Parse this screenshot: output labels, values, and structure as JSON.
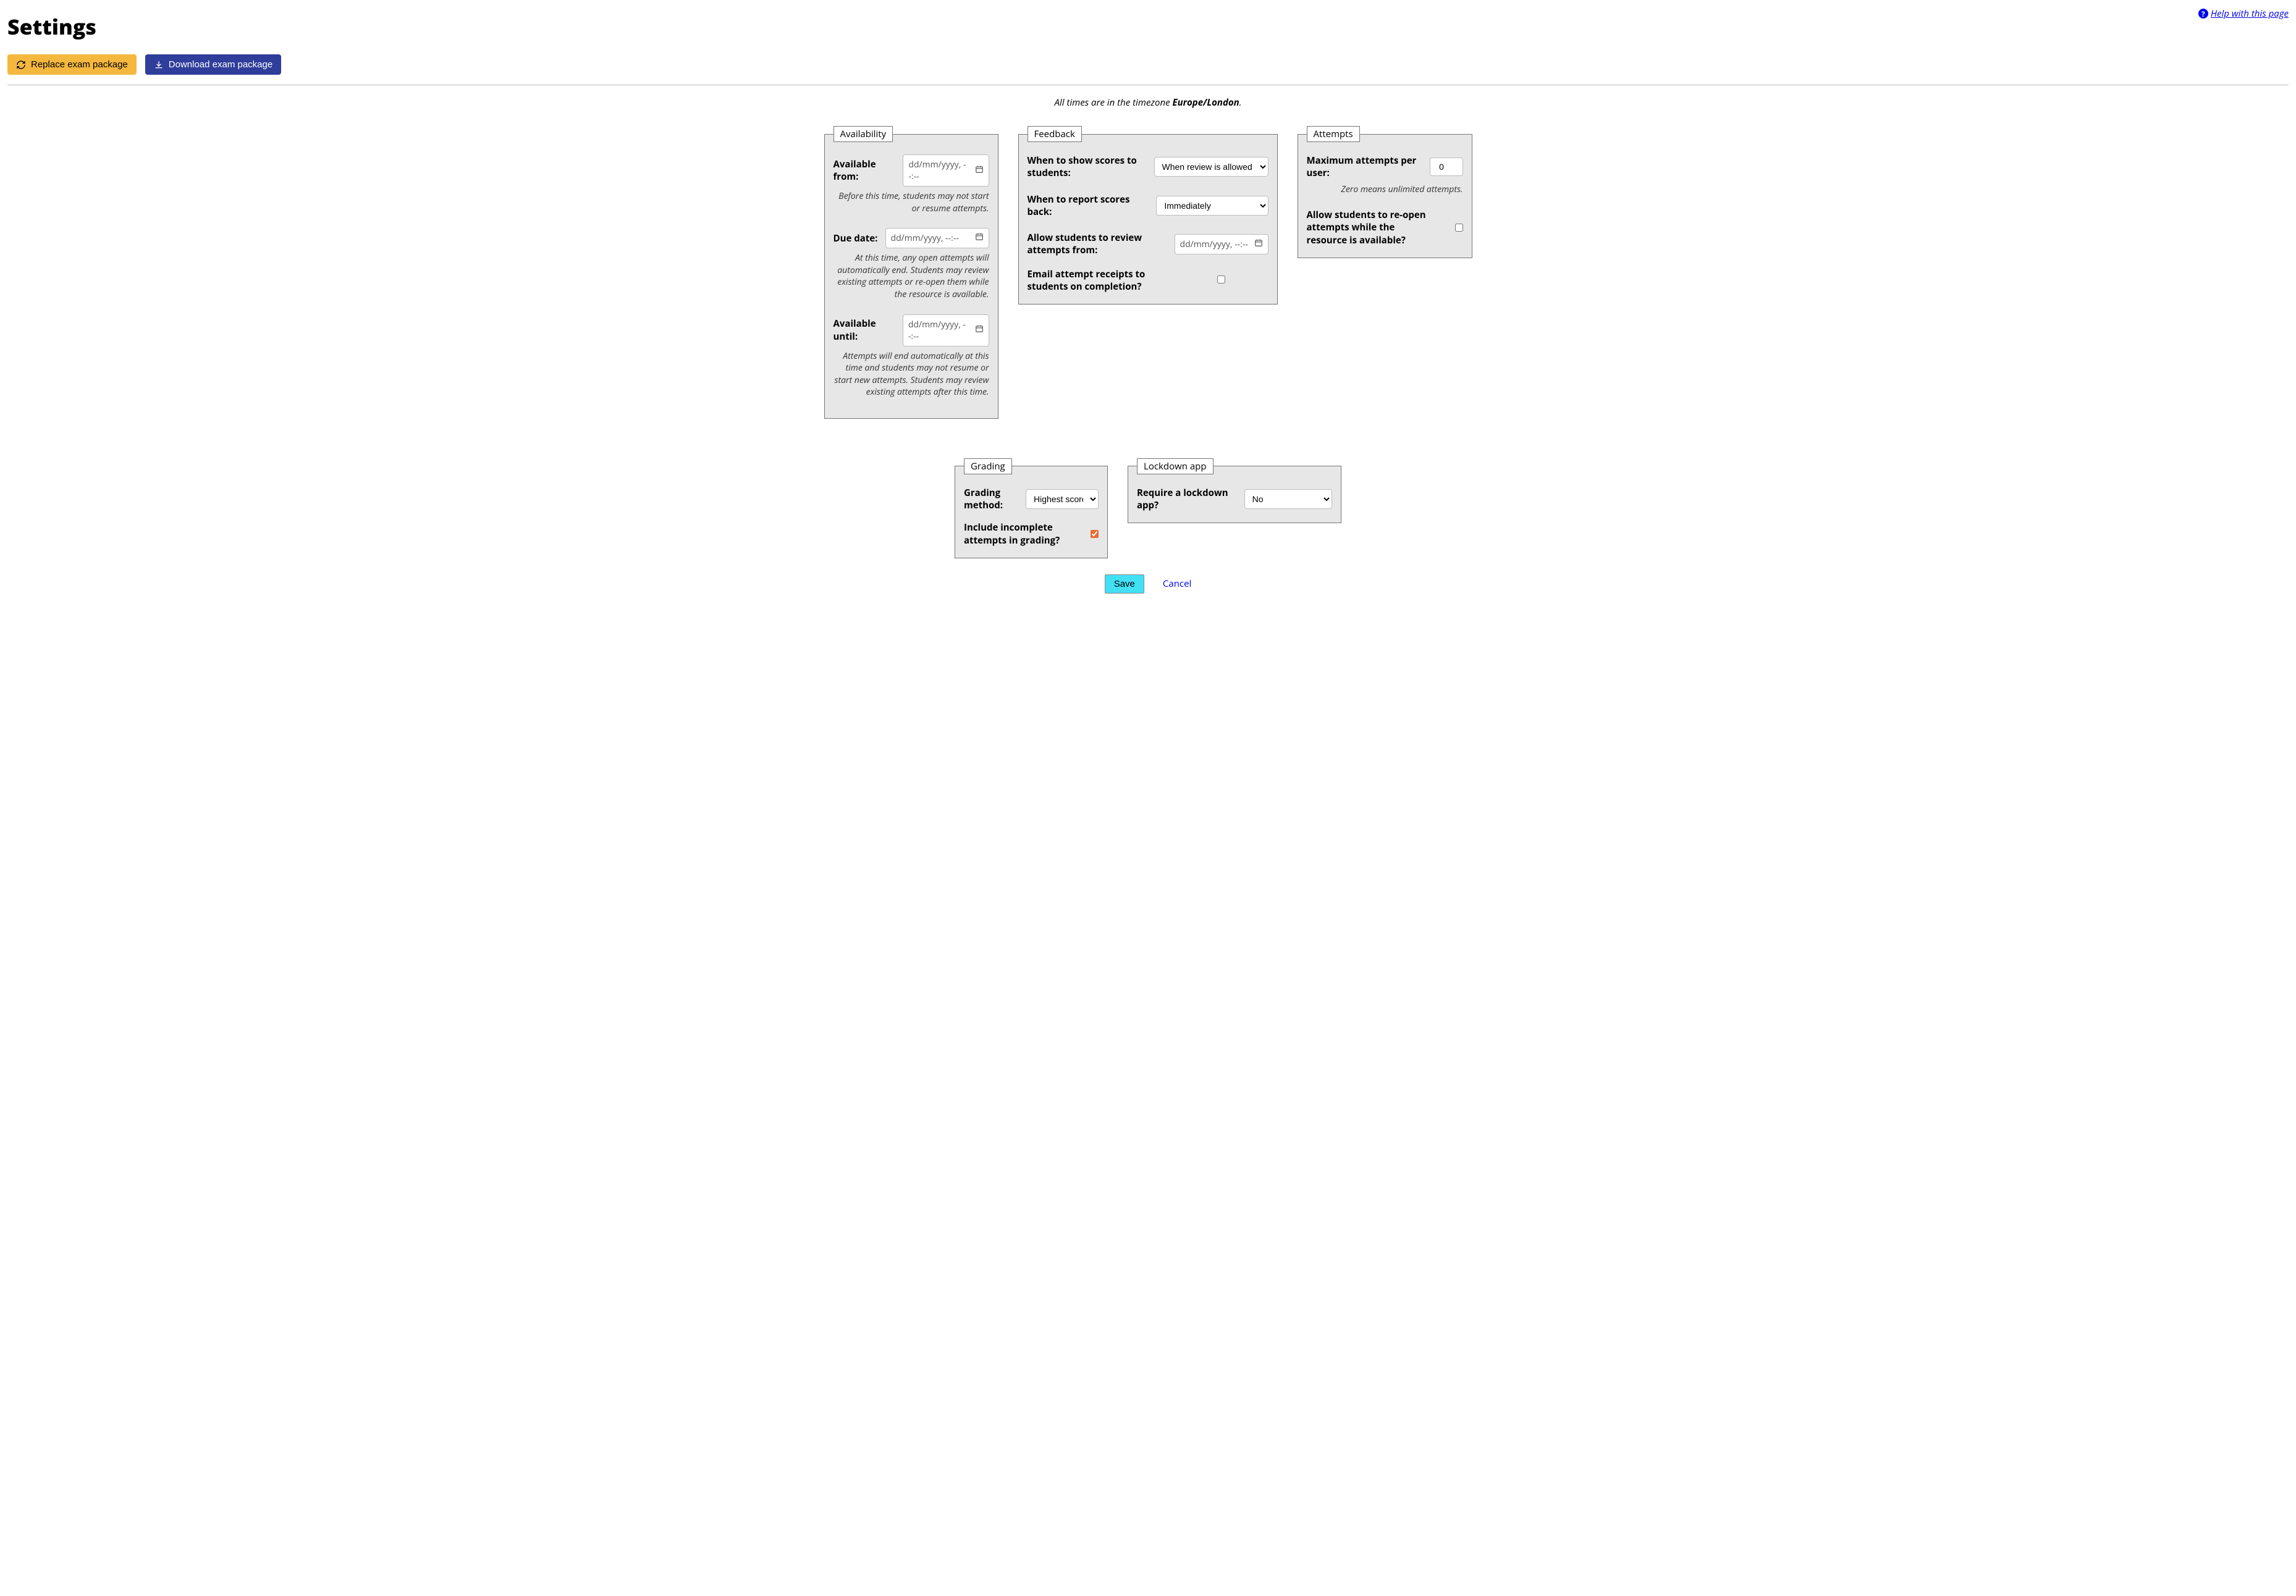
{
  "page": {
    "title": "Settings",
    "help_link": "Help with this page"
  },
  "actions": {
    "replace": "Replace exam package",
    "download": "Download exam package"
  },
  "timezone_note": {
    "prefix": "All times are in the timezone ",
    "zone": "Europe/London",
    "suffix": "."
  },
  "availability": {
    "legend": "Availability",
    "from_label": "Available from:",
    "from_placeholder": "dd/mm/yyyy, --:--",
    "from_hint": "Before this time, students may not start or resume attempts.",
    "due_label": "Due date:",
    "due_placeholder": "dd/mm/yyyy, --:--",
    "due_hint": "At this time, any open attempts will automatically end. Students may review existing attempts or re-open them while the resource is available.",
    "until_label": "Available until:",
    "until_placeholder": "dd/mm/yyyy, --:--",
    "until_hint": "Attempts will end automatically at this time and students may not resume or start new attempts. Students may review existing attempts after this time."
  },
  "feedback": {
    "legend": "Feedback",
    "show_scores_label": "When to show scores to students:",
    "show_scores_value": "When review is allowed",
    "report_label": "When to report scores back:",
    "report_value": "Immediately",
    "review_from_label": "Allow students to review attempts from:",
    "review_from_placeholder": "dd/mm/yyyy, --:--",
    "email_receipts_label": "Email attempt receipts to students on completion?",
    "email_receipts_checked": false
  },
  "attempts": {
    "legend": "Attempts",
    "max_label": "Maximum attempts per user:",
    "max_value": "0",
    "max_hint": "Zero means unlimited attempts.",
    "reopen_label": "Allow students to re-open attempts while the resource is available?",
    "reopen_checked": false
  },
  "grading": {
    "legend": "Grading",
    "method_label": "Grading method:",
    "method_value": "Highest score",
    "include_incomplete_label": "Include incomplete attempts in grading?",
    "include_incomplete_checked": true
  },
  "lockdown": {
    "legend": "Lockdown app",
    "require_label": "Require a lockdown app?",
    "require_value": "No"
  },
  "footer": {
    "save": "Save",
    "cancel": "Cancel"
  }
}
